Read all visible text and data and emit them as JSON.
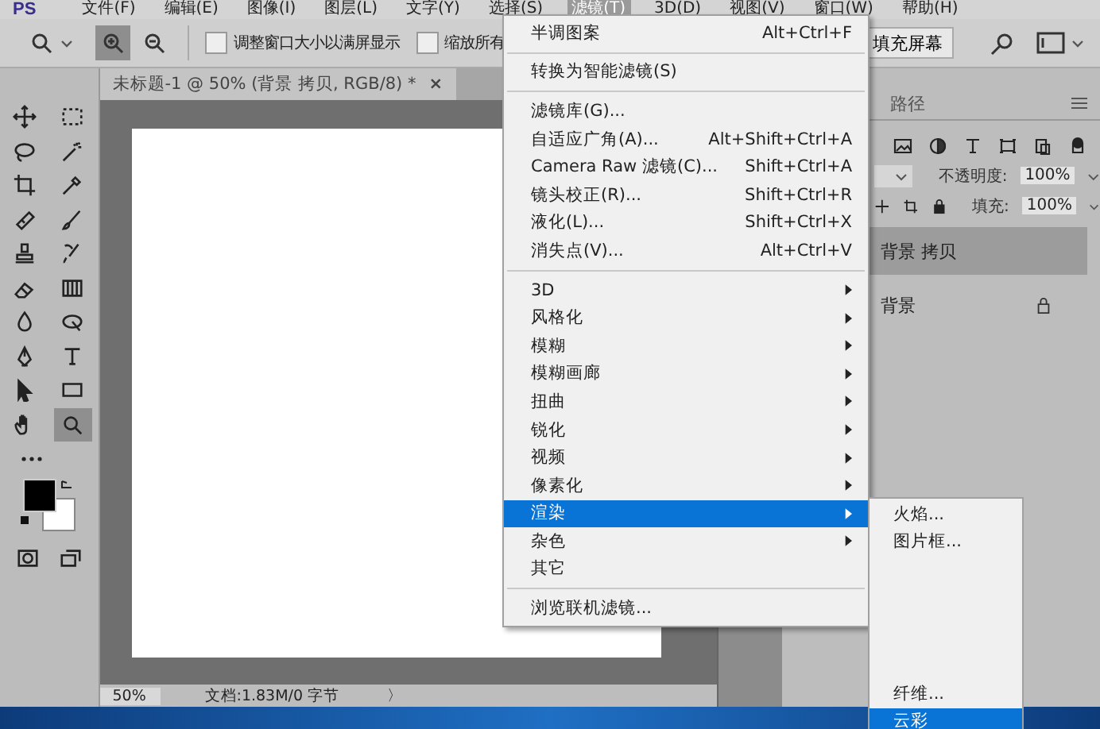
{
  "menu_bar": {
    "logo": "PS",
    "items": [
      {
        "label": "文件(F)",
        "selected": false
      },
      {
        "label": "编辑(E)",
        "selected": false
      },
      {
        "label": "图像(I)",
        "selected": false
      },
      {
        "label": "图层(L)",
        "selected": false
      },
      {
        "label": "文字(Y)",
        "selected": false
      },
      {
        "label": "选择(S)",
        "selected": false
      },
      {
        "label": "滤镜(T)",
        "selected": true
      },
      {
        "label": "3D(D)",
        "selected": false
      },
      {
        "label": "视图(V)",
        "selected": false
      },
      {
        "label": "窗口(W)",
        "selected": false
      },
      {
        "label": "帮助(H)",
        "selected": false
      }
    ]
  },
  "options_bar": {
    "zoom_in_selected": true,
    "checkboxes": [
      {
        "label": "调整窗口大小以满屏显示",
        "checked": false
      },
      {
        "label": "缩放所有",
        "checked": false
      }
    ],
    "fill_screen_button": "填充屏幕"
  },
  "document_tab": {
    "title": "未标题-1 @ 50% (背景 拷贝, RGB/8) *",
    "close": "×"
  },
  "toolbar": {
    "tools": [
      {
        "kind": "move",
        "selected": false
      },
      {
        "kind": "marquee",
        "selected": false
      },
      {
        "kind": "lasso",
        "selected": false
      },
      {
        "kind": "wand",
        "selected": false
      },
      {
        "kind": "crop",
        "selected": false
      },
      {
        "kind": "eyedropper",
        "selected": false
      },
      {
        "kind": "healing",
        "selected": false
      },
      {
        "kind": "brush",
        "selected": false
      },
      {
        "kind": "stamp",
        "selected": false
      },
      {
        "kind": "history",
        "selected": false
      },
      {
        "kind": "eraser",
        "selected": false
      },
      {
        "kind": "gradient",
        "selected": false
      },
      {
        "kind": "blur",
        "selected": false
      },
      {
        "kind": "dodge",
        "selected": false
      },
      {
        "kind": "pen",
        "selected": false
      },
      {
        "kind": "type",
        "selected": false
      },
      {
        "kind": "select",
        "selected": false
      },
      {
        "kind": "rectangle",
        "selected": false
      },
      {
        "kind": "hand",
        "selected": false
      },
      {
        "kind": "zoom",
        "selected": true
      }
    ]
  },
  "status_bar": {
    "zoom": "50%",
    "doc_info": "文档:1.83M/0 字节",
    "arrow": "〉"
  },
  "layers_panel": {
    "tab": "路径",
    "opacity_label": "不透明度:",
    "opacity": "100%",
    "fill_label": "填充:",
    "fill": "100%",
    "layers": [
      {
        "name": "背景 拷贝",
        "selected": true,
        "locked": false
      },
      {
        "name": "背景",
        "selected": false,
        "locked": true
      }
    ]
  },
  "filter_menu": {
    "groups": [
      [
        {
          "label": "半调图案",
          "shortcut": "Alt+Ctrl+F",
          "has_submenu": false,
          "selected": false
        }
      ],
      [
        {
          "label": "转换为智能滤镜(S)",
          "has_submenu": false,
          "selected": false
        }
      ],
      [
        {
          "label": "滤镜库(G)...",
          "has_submenu": false,
          "selected": false
        },
        {
          "label": "自适应广角(A)...",
          "shortcut": "Alt+Shift+Ctrl+A",
          "has_submenu": false,
          "selected": false
        },
        {
          "label": "Camera Raw 滤镜(C)...",
          "shortcut": "Shift+Ctrl+A",
          "has_submenu": false,
          "selected": false
        },
        {
          "label": "镜头校正(R)...",
          "shortcut": "Shift+Ctrl+R",
          "has_submenu": false,
          "selected": false
        },
        {
          "label": "液化(L)...",
          "shortcut": "Shift+Ctrl+X",
          "has_submenu": false,
          "selected": false
        },
        {
          "label": "消失点(V)...",
          "shortcut": "Alt+Ctrl+V",
          "has_submenu": false,
          "selected": false
        }
      ],
      [
        {
          "label": "3D",
          "has_submenu": true,
          "selected": false
        },
        {
          "label": "风格化",
          "has_submenu": true,
          "selected": false
        },
        {
          "label": "模糊",
          "has_submenu": true,
          "selected": false
        },
        {
          "label": "模糊画廊",
          "has_submenu": true,
          "selected": false
        },
        {
          "label": "扭曲",
          "has_submenu": true,
          "selected": false
        },
        {
          "label": "锐化",
          "has_submenu": true,
          "selected": false
        },
        {
          "label": "视频",
          "has_submenu": true,
          "selected": false
        },
        {
          "label": "像素化",
          "has_submenu": true,
          "selected": false
        },
        {
          "label": "渲染",
          "has_submenu": true,
          "selected": true
        },
        {
          "label": "杂色",
          "has_submenu": true,
          "selected": false
        },
        {
          "label": "其它",
          "has_submenu": false,
          "selected": false
        }
      ],
      [
        {
          "label": "浏览联机滤镜...",
          "has_submenu": false,
          "selected": false
        }
      ]
    ]
  },
  "render_submenu": {
    "top_items": [
      {
        "label": "火焰...",
        "selected": false
      },
      {
        "label": "图片框...",
        "selected": false
      }
    ],
    "bottom_items": [
      {
        "label": "纤维...",
        "selected": false
      },
      {
        "label": "云彩",
        "selected": true
      }
    ]
  }
}
